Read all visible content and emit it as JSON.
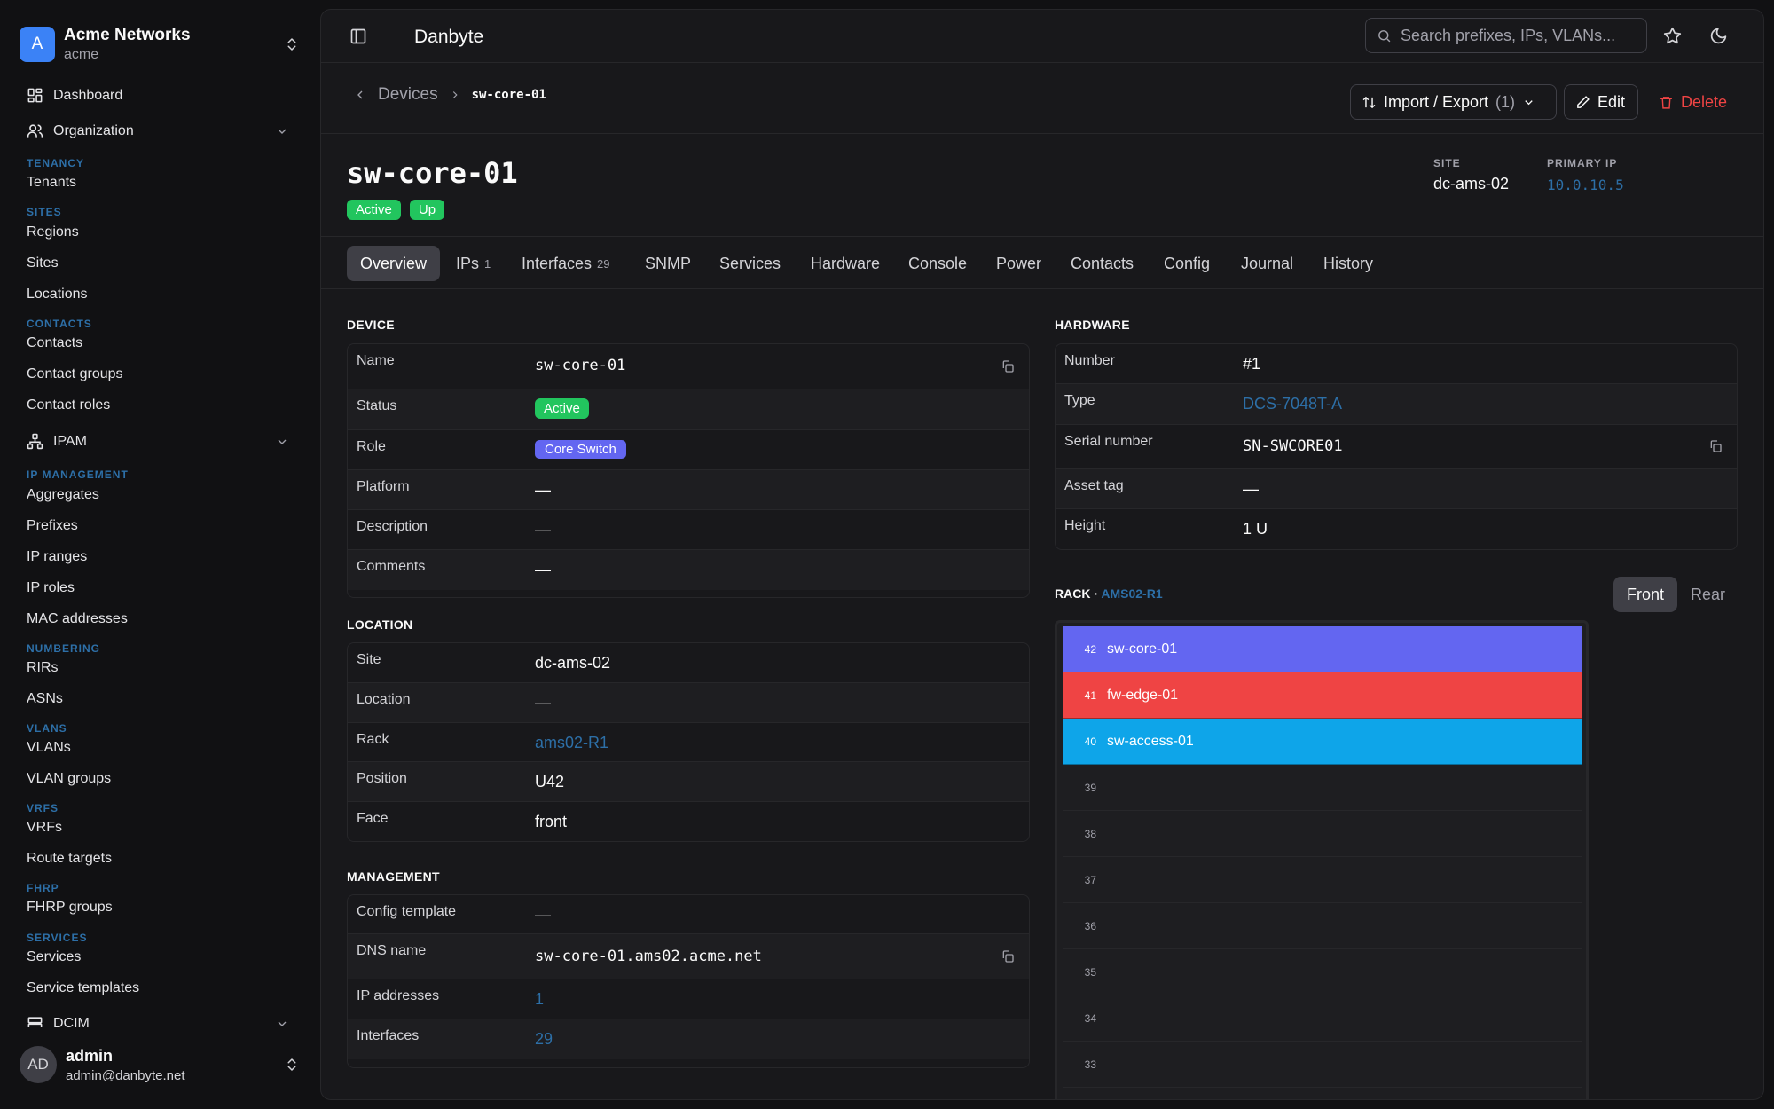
{
  "org": {
    "initial": "A",
    "name": "Acme Networks",
    "slug": "acme"
  },
  "nav": {
    "dashboard": "Dashboard",
    "organization": "Organization",
    "sec_tenancy": "TENANCY",
    "tenants": "Tenants",
    "sec_sites": "SITES",
    "regions": "Regions",
    "sites": "Sites",
    "locations": "Locations",
    "sec_contacts": "CONTACTS",
    "contacts": "Contacts",
    "contact_groups": "Contact groups",
    "contact_roles": "Contact roles",
    "ipam": "IPAM",
    "sec_ipmgmt": "IP MANAGEMENT",
    "aggregates": "Aggregates",
    "prefixes": "Prefixes",
    "ip_ranges": "IP ranges",
    "ip_roles": "IP roles",
    "mac_addresses": "MAC addresses",
    "sec_numbering": "NUMBERING",
    "rirs": "RIRs",
    "asns": "ASNs",
    "sec_vlans": "VLANS",
    "vlans": "VLANs",
    "vlan_groups": "VLAN groups",
    "sec_vrfs": "VRFS",
    "vrfs": "VRFs",
    "route_targets": "Route targets",
    "sec_fhrp": "FHRP",
    "fhrp_groups": "FHRP groups",
    "sec_services": "SERVICES",
    "services": "Services",
    "service_templates": "Service templates",
    "dcim": "DCIM"
  },
  "user": {
    "initials": "AD",
    "name": "admin",
    "email": "admin@danbyte.net"
  },
  "topbar": {
    "title": "Danbyte",
    "search_placeholder": "Search prefixes, IPs, VLANs..."
  },
  "breadcrumb": {
    "parent": "Devices",
    "current": "sw-core-01"
  },
  "actions": {
    "import_export": "Import / Export",
    "import_count": "(1)",
    "edit": "Edit",
    "delete": "Delete"
  },
  "device": {
    "title": "sw-core-01",
    "status": "Active",
    "oper": "Up",
    "site_label": "SITE",
    "site": "dc-ams-02",
    "primary_ip_label": "PRIMARY IP",
    "primary_ip": "10.0.10.5"
  },
  "tabs": [
    {
      "label": "Overview",
      "count": ""
    },
    {
      "label": "IPs",
      "count": "1"
    },
    {
      "label": "Interfaces",
      "count": "29"
    },
    {
      "label": "SNMP",
      "count": ""
    },
    {
      "label": "Services",
      "count": ""
    },
    {
      "label": "Hardware",
      "count": ""
    },
    {
      "label": "Console",
      "count": ""
    },
    {
      "label": "Power",
      "count": ""
    },
    {
      "label": "Contacts",
      "count": ""
    },
    {
      "label": "Config",
      "count": ""
    },
    {
      "label": "Journal",
      "count": ""
    },
    {
      "label": "History",
      "count": ""
    }
  ],
  "device_section": {
    "title": "DEVICE",
    "name_label": "Name",
    "name": "sw-core-01",
    "status_label": "Status",
    "status": "Active",
    "role_label": "Role",
    "role": "Core Switch",
    "platform_label": "Platform",
    "platform": "—",
    "description_label": "Description",
    "description": "—",
    "comments_label": "Comments",
    "comments": "—"
  },
  "location_section": {
    "title": "LOCATION",
    "site_label": "Site",
    "site": "dc-ams-02",
    "location_label": "Location",
    "location": "—",
    "rack_label": "Rack",
    "rack": "ams02-R1",
    "position_label": "Position",
    "position": "U42",
    "face_label": "Face",
    "face": "front"
  },
  "management_section": {
    "title": "MANAGEMENT",
    "config_label": "Config template",
    "config": "—",
    "dns_label": "DNS name",
    "dns": "sw-core-01.ams02.acme.net",
    "ips_label": "IP addresses",
    "ips": "1",
    "interfaces_label": "Interfaces",
    "interfaces": "29"
  },
  "hardware_section": {
    "title": "HARDWARE",
    "number_label": "Number",
    "number": "#1",
    "type_label": "Type",
    "type": "DCS-7048T-A",
    "serial_label": "Serial number",
    "serial": "SN-SWCORE01",
    "asset_label": "Asset tag",
    "asset": "—",
    "height_label": "Height",
    "height": "1 U"
  },
  "rack": {
    "label": "RACK ·",
    "name": "AMS02-R1",
    "front": "Front",
    "rear": "Rear",
    "units": [
      {
        "u": "42",
        "device": "sw-core-01",
        "color": "#6366f1"
      },
      {
        "u": "41",
        "device": "fw-edge-01",
        "color": "#ef4444"
      },
      {
        "u": "40",
        "device": "sw-access-01",
        "color": "#0ea5e9"
      },
      {
        "u": "39",
        "device": "",
        "color": ""
      },
      {
        "u": "38",
        "device": "",
        "color": ""
      },
      {
        "u": "37",
        "device": "",
        "color": ""
      },
      {
        "u": "36",
        "device": "",
        "color": ""
      },
      {
        "u": "35",
        "device": "",
        "color": ""
      },
      {
        "u": "34",
        "device": "",
        "color": ""
      },
      {
        "u": "33",
        "device": "",
        "color": ""
      }
    ]
  },
  "colors": {
    "accent_link": "#2d6fa7",
    "status_green": "#22c55e",
    "role_indigo": "#6366f1",
    "danger": "#ef4444"
  }
}
